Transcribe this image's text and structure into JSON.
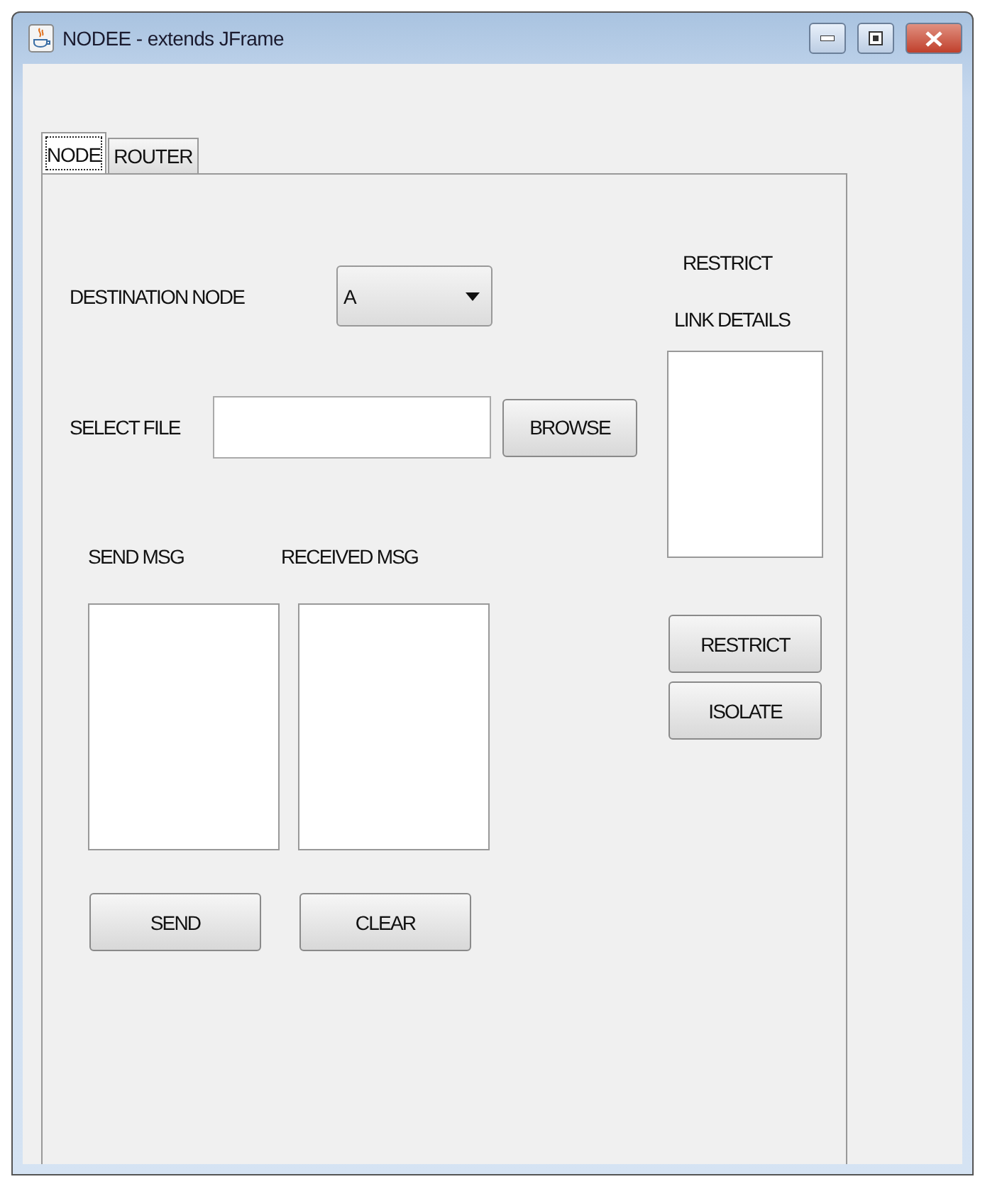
{
  "window": {
    "title": "NODEE - extends JFrame"
  },
  "tabs": [
    {
      "label": "NODE",
      "selected": true
    },
    {
      "label": "ROUTER",
      "selected": false
    }
  ],
  "destination": {
    "label": "DESTINATION NODE",
    "value": "A"
  },
  "select_file": {
    "label": "SELECT FILE",
    "button": "BROWSE"
  },
  "messages": [
    {
      "label": "SEND MSG",
      "button": "SEND"
    },
    {
      "label": "RECEIVED MSG",
      "button": "CLEAR"
    }
  ],
  "restrict_panel": {
    "heading": "RESTRICT",
    "list_label": "LINK DETAILS",
    "buttons": [
      "RESTRICT",
      "ISOLATE"
    ]
  }
}
